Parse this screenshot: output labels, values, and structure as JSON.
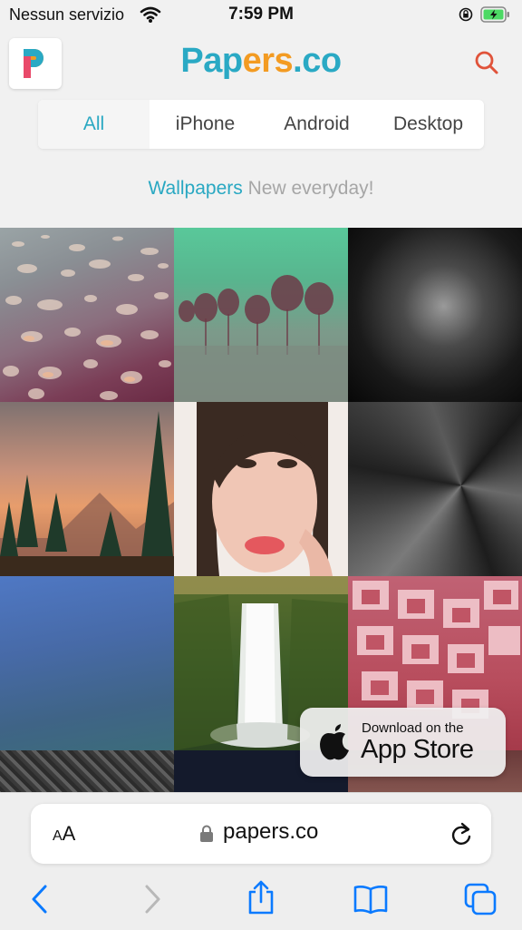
{
  "status": {
    "carrier": "Nessun servizio",
    "time": "7:59 PM"
  },
  "header": {
    "brand_part1": "Pap",
    "brand_part2": "ers",
    "brand_part3": ".co",
    "logo_letter": "P"
  },
  "tabs": [
    {
      "label": "All"
    },
    {
      "label": "iPhone"
    },
    {
      "label": "Android"
    },
    {
      "label": "Desktop"
    }
  ],
  "tagline": {
    "highlight": "Wallpapers",
    "rest": "New everyday!"
  },
  "appstore": {
    "line1": "Download on the",
    "line2": "App Store"
  },
  "browser": {
    "aa_small": "A",
    "aa_big": "A",
    "url": "papers.co"
  },
  "icons": [
    "wifi-icon",
    "lock-rotation-icon",
    "battery-icon",
    "search-icon",
    "apple-icon",
    "padlock-icon",
    "reload-icon",
    "back-icon",
    "forward-icon",
    "share-icon",
    "bookmarks-icon",
    "tabs-icon"
  ],
  "colors": {
    "accent": "#29a8c2",
    "brand_orange": "#f39b22",
    "search": "#e0533a",
    "ios_blue": "#0a7aff"
  }
}
